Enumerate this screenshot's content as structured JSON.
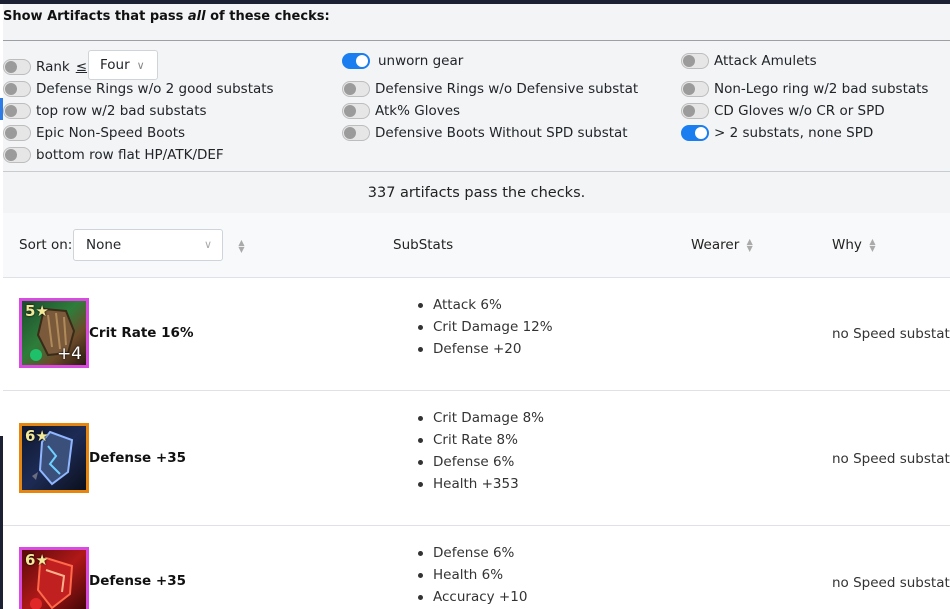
{
  "filters": {
    "title_prefix": "Show Artifacts that pass ",
    "title_emph": "all",
    "title_suffix": " of these checks:",
    "rank_label": "Rank",
    "rank_op": "≤",
    "rank_value": "Four",
    "options": [
      {
        "label": "Defense Rings w/o 2 good substats",
        "on": false
      },
      {
        "label": "top row w/2 bad substats",
        "on": false
      },
      {
        "label": "Epic Non-Speed Boots",
        "on": false
      },
      {
        "label": "bottom row flat HP/ATK/DEF",
        "on": false
      },
      {
        "label": "unworn gear",
        "on": true
      },
      {
        "label": "Defensive Rings w/o Defensive substat",
        "on": false
      },
      {
        "label": "Atk% Gloves",
        "on": false
      },
      {
        "label": "Defensive Boots Without SPD substat",
        "on": false
      },
      {
        "label": "Attack Amulets",
        "on": false
      },
      {
        "label": "Non-Lego ring w/2 bad substats",
        "on": false
      },
      {
        "label": "CD Gloves w/o CR or SPD",
        "on": false
      },
      {
        "label": "> 2 substats, none SPD",
        "on": true
      }
    ]
  },
  "summary": "337 artifacts pass the checks.",
  "table": {
    "sort_label": "Sort on:",
    "sort_value": "None",
    "col_substats": "SubStats",
    "col_wearer": "Wearer",
    "col_why": "Why",
    "rows": [
      {
        "stars": "5★",
        "level": "+4",
        "main": "Crit Rate 16%",
        "subs": [
          "Attack 6%",
          "Crit Damage 12%",
          "Defense +20"
        ],
        "why": "no Speed substat",
        "frame": "#d84ae0"
      },
      {
        "stars": "6★",
        "level": "",
        "main": "Defense +35",
        "subs": [
          "Crit Damage 8%",
          "Crit Rate 8%",
          "Defense 6%",
          "Health +353"
        ],
        "why": "no Speed substat",
        "frame": "#e6860e"
      },
      {
        "stars": "6★",
        "level": "",
        "main": "Defense +35",
        "subs": [
          "Defense 6%",
          "Health 6%",
          "Accuracy +10"
        ],
        "why": "no Speed substat",
        "frame": "#d84ae0"
      }
    ]
  }
}
